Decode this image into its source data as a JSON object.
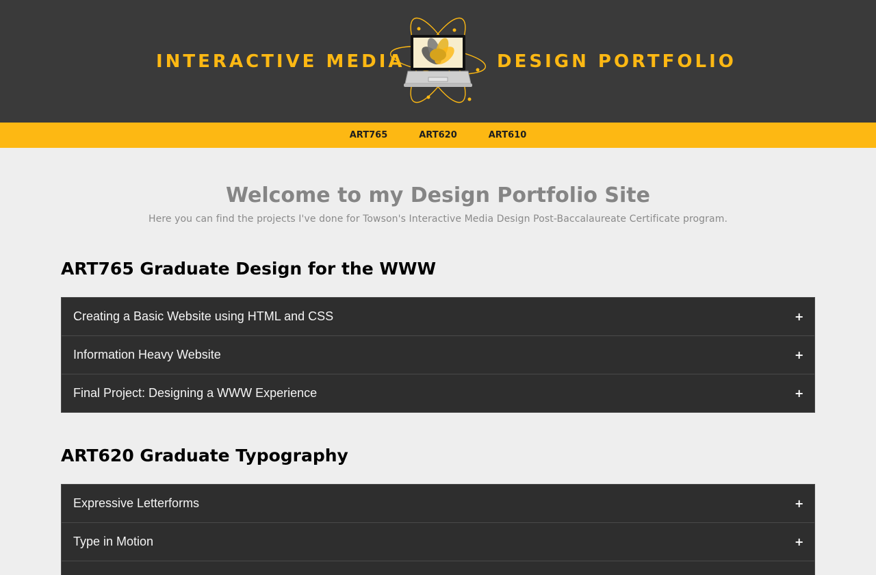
{
  "header": {
    "brand_left": "INTERACTIVE MEDIA",
    "brand_right": "DESIGN PORTFOLIO",
    "logo_icon": "laptop-atom-logo-icon",
    "colors": {
      "background": "#3a3a3a",
      "accent": "#fdb813"
    }
  },
  "nav": {
    "items": [
      {
        "label": "ART765"
      },
      {
        "label": "ART620"
      },
      {
        "label": "ART610"
      }
    ]
  },
  "intro": {
    "title": "Welcome to my Design Portfolio Site",
    "subtitle": "Here you can find the projects I've done for Towson's Interactive Media Design Post-Baccalaureate Certificate program."
  },
  "sections": [
    {
      "heading": "ART765 Graduate Design for the WWW",
      "items": [
        {
          "label": "Creating a Basic Website using HTML and CSS",
          "icon": "+"
        },
        {
          "label": "Information Heavy Website",
          "icon": "+"
        },
        {
          "label": "Final Project: Designing a WWW Experience",
          "icon": "+"
        }
      ]
    },
    {
      "heading": "ART620 Graduate Typography",
      "items": [
        {
          "label": "Expressive Letterforms",
          "icon": "+"
        },
        {
          "label": "Type in Motion",
          "icon": "+"
        },
        {
          "label": "",
          "icon": ""
        }
      ]
    }
  ]
}
